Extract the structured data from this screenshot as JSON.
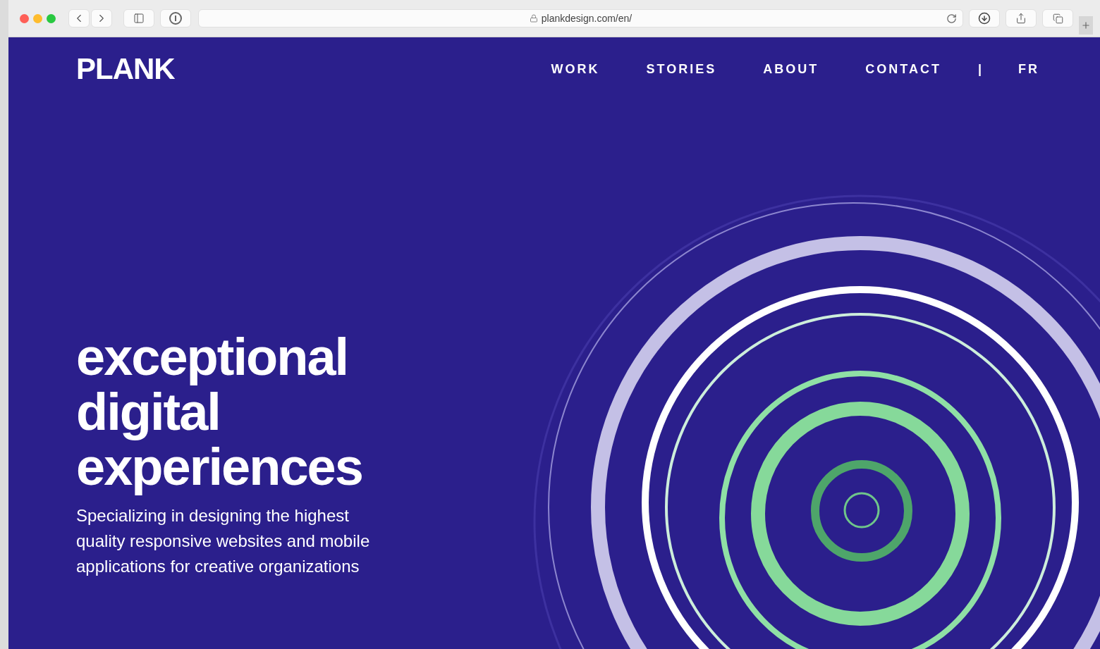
{
  "browser": {
    "url": "plankdesign.com/en/"
  },
  "header": {
    "logo": "PLANK",
    "nav": [
      "WORK",
      "STORIES",
      "ABOUT",
      "CONTACT"
    ],
    "separator": "|",
    "language": "FR"
  },
  "hero": {
    "heading": "exceptional digital experiences",
    "subheading": "Specializing in designing the highest quality responsive websites and mobile applications for creative organizations"
  }
}
